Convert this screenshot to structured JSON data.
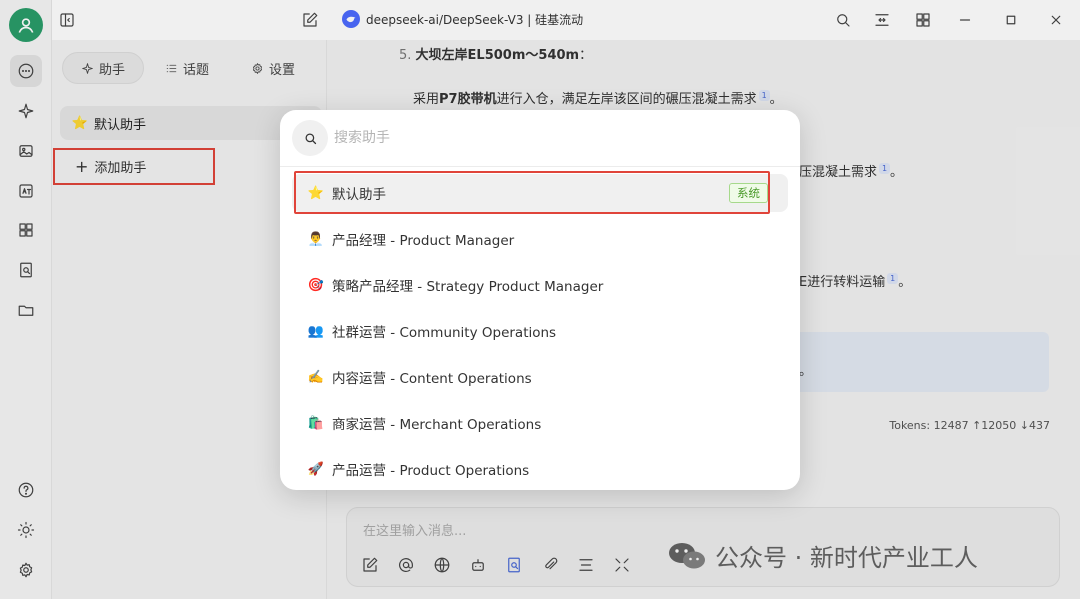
{
  "window": {
    "title": "deepseek-ai/DeepSeek-V3 | 硅基流动"
  },
  "sidebar": {
    "tabs": [
      {
        "label": "助手"
      },
      {
        "label": "话题"
      },
      {
        "label": "设置"
      }
    ],
    "assistant_item": "默认助手",
    "add_assistant": "添加助手"
  },
  "chat": {
    "lines": [
      {
        "prefix": "5. ",
        "bold": "大坝左岸EL500m～540m",
        "suffix": "："
      },
      {
        "pre": "采用",
        "bold": "P7胶带机",
        "post": "进行入仓，满足左岸该区间的碾压混凝土需求",
        "sup": "1",
        "end": "。"
      },
      {
        "text": "压混凝土需求",
        "sup": "1",
        "end": "。"
      },
      {
        "text": "E进行转料运输",
        "sup": "1",
        "end": "。"
      },
      {
        "text": "。"
      }
    ],
    "tokens": "Tokens: 12487 ↑12050 ↓437",
    "input_placeholder": "在这里输入消息..."
  },
  "watermark": "公众号 · 新时代产业工人",
  "search_modal": {
    "placeholder": "搜索助手",
    "items": [
      {
        "emoji": "⭐",
        "label": "默认助手",
        "badge": "系统"
      },
      {
        "emoji": "👨‍💼",
        "label": "产品经理 - Product Manager"
      },
      {
        "emoji": "🎯",
        "label": "策略产品经理 - Strategy Product Manager"
      },
      {
        "emoji": "👥",
        "label": "社群运营 - Community Operations"
      },
      {
        "emoji": "✍️",
        "label": "内容运营 - Content Operations"
      },
      {
        "emoji": "🛍️",
        "label": "商家运营 - Merchant Operations"
      },
      {
        "emoji": "🚀",
        "label": "产品运营 - Product Operations"
      }
    ]
  },
  "colors": {
    "accent_green": "#2a9d6a",
    "highlight_red": "#e0443a",
    "badge_green": "#4a9a2a"
  }
}
